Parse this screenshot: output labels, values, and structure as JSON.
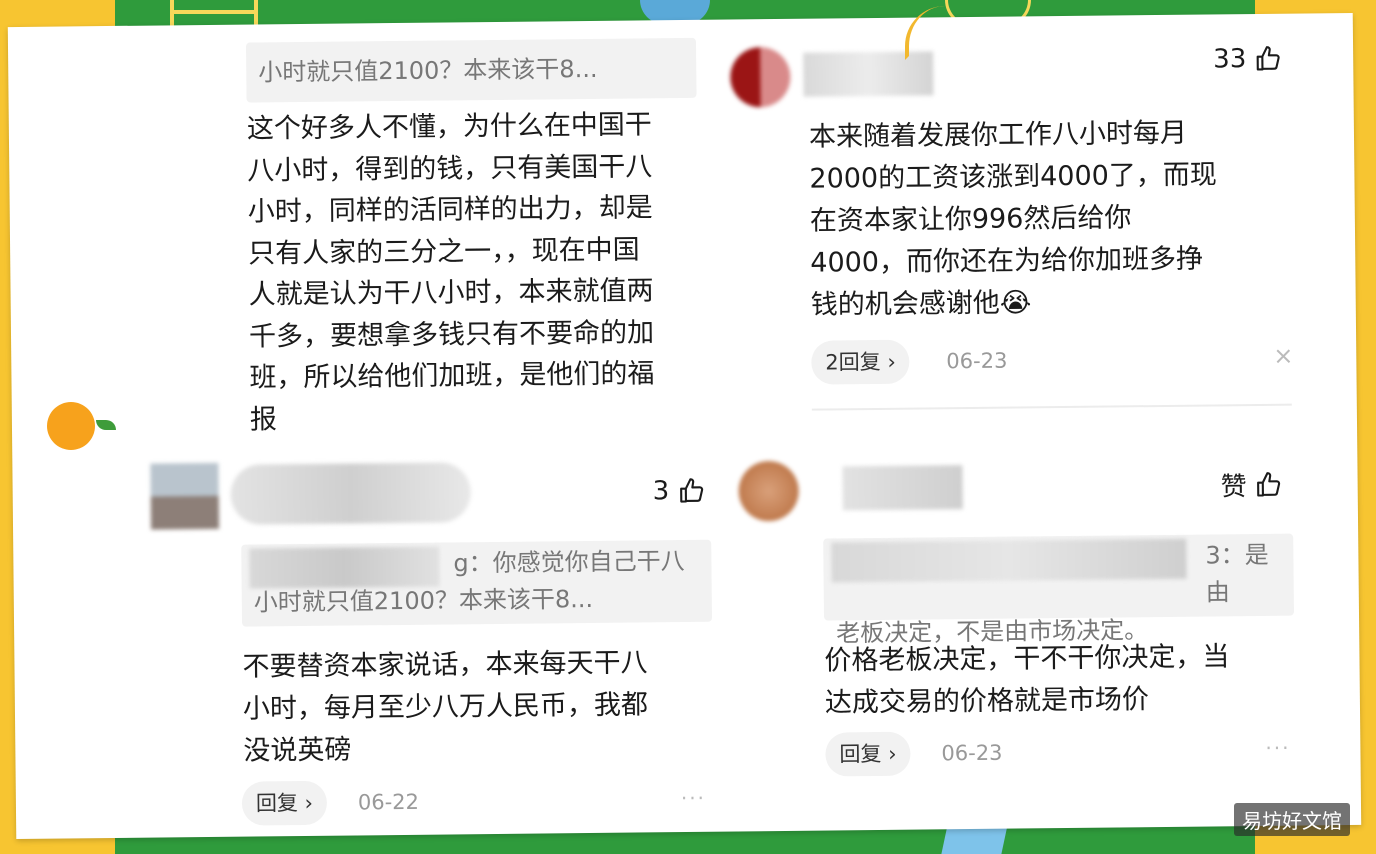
{
  "comments": [
    {
      "quote": "小时就只值2100？本来该干8...",
      "body_lines": [
        "这个好多人不懂，为什么在中国干",
        "八小时，得到的钱，只有美国干八",
        "小时，同样的活同样的出力，却是",
        "只有人家的三分之一，，现在中国",
        "人就是认为干八小时，本来就值两",
        "千多，要想拿多钱只有不要命的加",
        "班，所以给他们加班，是他们的福",
        "报"
      ]
    },
    {
      "likes": "33",
      "body_lines": [
        "本来随着发展你工作八小时每月",
        "2000的工资该涨到4000了，而现",
        "在资本家让你996然后给你",
        "4000，而你还在为给你加班多挣",
        "钱的机会感谢他"
      ],
      "emoji": "😭",
      "reply_label": "2回复 ›",
      "date": "06-23",
      "close_icon": "×"
    },
    {
      "likes": "3",
      "quote_line1": "g：你感觉你自己干八",
      "quote_line2": "小时就只值2100？本来该干8...",
      "body_lines": [
        "不要替资本家说话，本来每天干八",
        "小时，每月至少八万人民币，我都",
        "没说英磅"
      ],
      "reply_label": "回复 ›",
      "date": "06-22",
      "more": "···"
    },
    {
      "likes": "赞",
      "quote_line1": "3：是由",
      "quote_line2": "老板决定，不是由市场决定。",
      "body_lines": [
        "价格老板决定，干不干你决定，当",
        "达成交易的价格就是市场价"
      ],
      "reply_label": "回复 ›",
      "date": "06-23",
      "more": "···"
    }
  ],
  "watermark": "易坊好文馆",
  "colors": {
    "background_yellow": "#f7c531",
    "background_green": "#2f9b3c",
    "card": "#ffffff",
    "quote_bg": "#f2f2f2",
    "muted_text": "#999999"
  }
}
